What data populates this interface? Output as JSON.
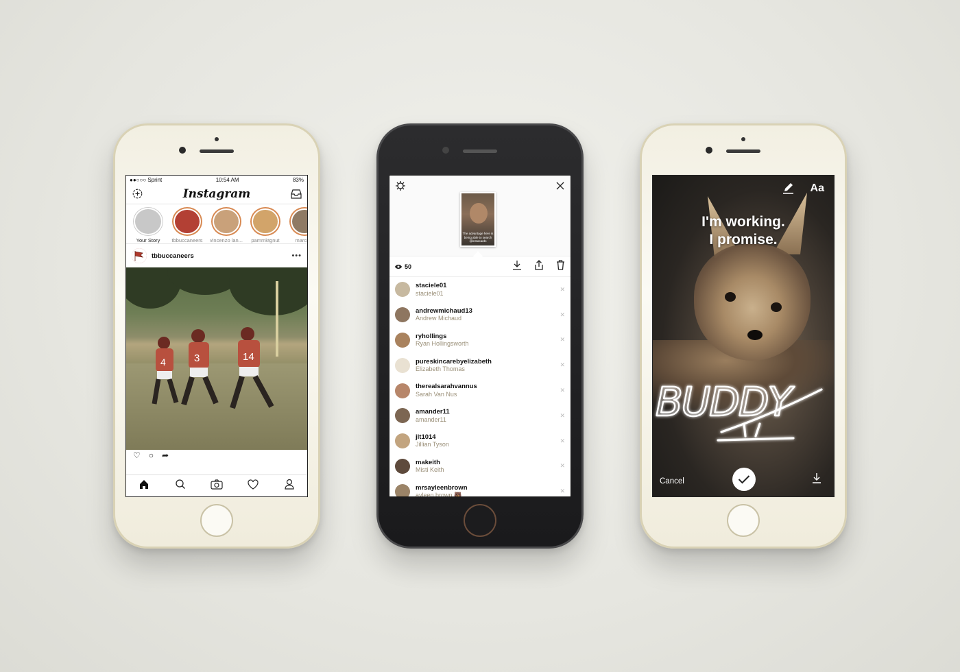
{
  "feed": {
    "status": {
      "carrier": "●●○○○ Sprint",
      "time": "10:54 AM",
      "battery": "83%"
    },
    "logo": "Instagram",
    "stories": [
      {
        "name": "Your Story",
        "own": true,
        "color": "#c8c8c8"
      },
      {
        "name": "tbbuccaneers",
        "own": false,
        "color": "#b34034"
      },
      {
        "name": "vincenzo lan...",
        "own": false,
        "color": "#c9a17a"
      },
      {
        "name": "pammktgnut",
        "own": false,
        "color": "#d2a46a"
      },
      {
        "name": "marcma",
        "own": false,
        "color": "#8f7a64"
      }
    ],
    "post": {
      "username": "tbbuccaneers",
      "more": "•••"
    },
    "tabs": [
      "home-icon",
      "search-icon",
      "camera-icon",
      "heart-icon",
      "profile-icon"
    ]
  },
  "viewers": {
    "thumb_text": "The advantage here is being able to search @instacards",
    "count": "50",
    "list": [
      {
        "username": "staciele01",
        "name": "staciele01",
        "color": "#c7b9a0"
      },
      {
        "username": "andrewmichaud13",
        "name": "Andrew Michaud",
        "color": "#8e7660"
      },
      {
        "username": "ryhollings",
        "name": "Ryan Hollingsworth",
        "color": "#a9825e"
      },
      {
        "username": "pureskincarebyelizabeth",
        "name": "Elizabeth Thomas",
        "color": "#e9e1d2"
      },
      {
        "username": "therealsarahvannus",
        "name": "Sarah Van Nus",
        "color": "#b7866a"
      },
      {
        "username": "amander11",
        "name": "amander11",
        "color": "#7c6652"
      },
      {
        "username": "jlt1014",
        "name": "Jillian Tyson",
        "color": "#c2a47f"
      },
      {
        "username": "makeith",
        "name": "Misti Keith",
        "color": "#5e4a3c"
      },
      {
        "username": "mrsayleenbrown",
        "name": "ayleen brown 🐻",
        "color": "#9b8468"
      }
    ]
  },
  "editor": {
    "caption_line1": "I'm working.",
    "caption_line2": "I promise.",
    "text_tool": "Aa",
    "doodle_text": "BUDDY",
    "cancel": "Cancel"
  }
}
